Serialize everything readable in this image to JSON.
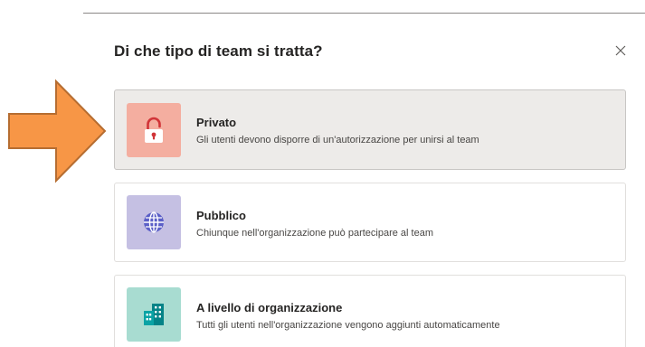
{
  "dialog": {
    "title": "Di che tipo di team si tratta?",
    "close_icon": "close-icon"
  },
  "options": [
    {
      "title": "Privato",
      "description": "Gli utenti devono disporre di un'autorizzazione per unirsi al team",
      "icon": "lock-icon",
      "tile_color": "#f4aea0",
      "icon_color": "#d13438",
      "selected": true
    },
    {
      "title": "Pubblico",
      "description": "Chiunque nell'organizzazione può partecipare al team",
      "icon": "globe-icon",
      "tile_color": "#c5c0e3",
      "icon_color": "#5b5fc7",
      "selected": false
    },
    {
      "title": "A livello di organizzazione",
      "description": "Tutti gli utenti nell'organizzazione vengono aggiunti automaticamente",
      "icon": "building-icon",
      "tile_color": "#a8dcd1",
      "icon_color": "#038387",
      "selected": false
    }
  ],
  "annotation": {
    "icon": "arrow-right-icon",
    "fill_color": "#f79646",
    "stroke_color": "#b66d31"
  }
}
